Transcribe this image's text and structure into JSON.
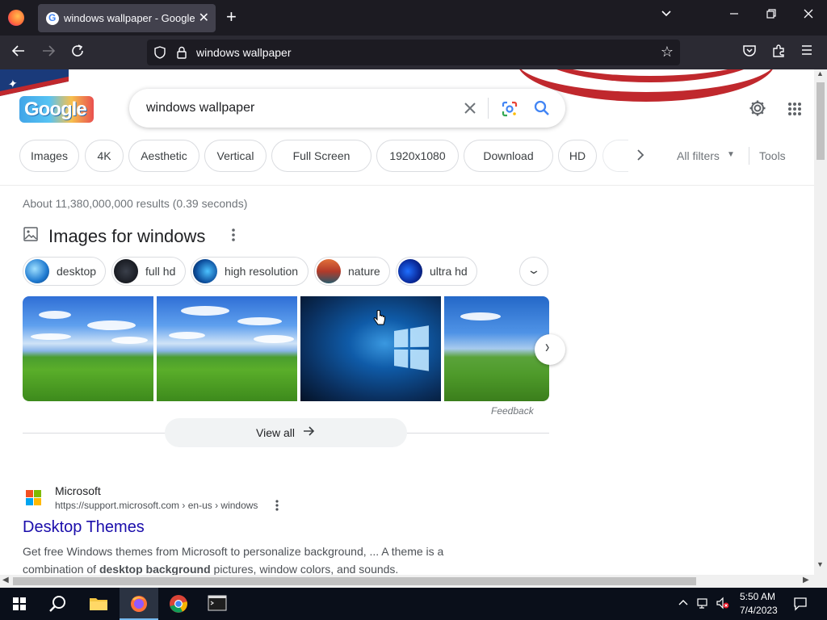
{
  "browser": {
    "tab_title": "windows wallpaper - Google Search",
    "url": "windows wallpaper"
  },
  "search": {
    "logo_text": "Google",
    "query": "windows wallpaper"
  },
  "filters": [
    {
      "label": "Images"
    },
    {
      "label": "4K"
    },
    {
      "label": "Aesthetic"
    },
    {
      "label": "Vertical"
    },
    {
      "label": "Full Screen"
    },
    {
      "label": "1920x1080"
    },
    {
      "label": "Download"
    },
    {
      "label": "HD"
    }
  ],
  "filters_extra": {
    "all_filters": "All filters",
    "tools": "Tools"
  },
  "result_stats": "About 11,380,000,000 results (0.39 seconds)",
  "images_section": {
    "title": "Images for windows",
    "refinements": [
      {
        "label": "desktop"
      },
      {
        "label": "full hd"
      },
      {
        "label": "high resolution"
      },
      {
        "label": "nature"
      },
      {
        "label": "ultra hd"
      }
    ],
    "feedback": "Feedback",
    "view_all": "View all"
  },
  "result": {
    "site_name": "Microsoft",
    "url": "https://support.microsoft.com › en-us › windows",
    "title": "Desktop Themes",
    "snippet_1": "Get free Windows themes from Microsoft to personalize background, ... A theme is a",
    "snippet_2_pre": "combination of ",
    "snippet_2_bold": "desktop background",
    "snippet_2_post": " pictures, window colors, and sounds."
  },
  "taskbar": {
    "time": "5:50 AM",
    "date": "7/4/2023"
  },
  "colors": {
    "link": "#1a0dab",
    "chrome_dark": "#1c1b22",
    "toolbar": "#2b2a33",
    "flag_red": "#c0282d"
  }
}
